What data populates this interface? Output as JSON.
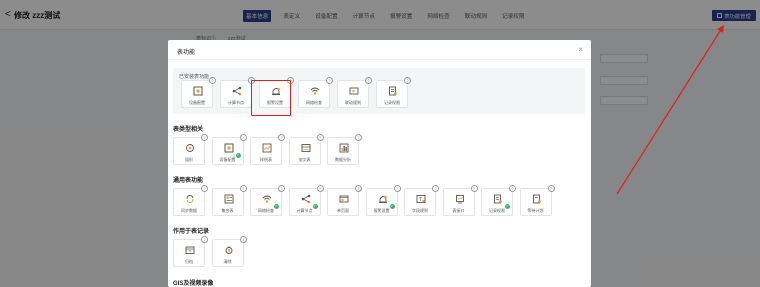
{
  "header": {
    "back_glyph": "<",
    "title": "修改 zzz测试",
    "tabs": [
      "基本信息",
      "表定义",
      "设备配置",
      "计算节点",
      "报警设置",
      "网络检查",
      "联动规则",
      "记录权限"
    ],
    "active_tab_index": 0,
    "manage_button": "表功能管理"
  },
  "background": {
    "label_1": "表标识①",
    "value_1": "zzz测试"
  },
  "modal": {
    "title": "表功能",
    "close_glyph": "×",
    "installed": {
      "label": "已安装表功能",
      "items": [
        {
          "label": "设备配置",
          "icon": "device-config-icon"
        },
        {
          "label": "计算节点",
          "icon": "compute-node-icon"
        },
        {
          "label": "报警设置",
          "icon": "alarm-icon",
          "selected": true
        },
        {
          "label": "网络检查",
          "icon": "wifi-icon"
        },
        {
          "label": "联动规则",
          "icon": "linkage-icon"
        },
        {
          "label": "记录权限",
          "icon": "record-permission-icon"
        }
      ]
    },
    "sections": [
      {
        "title": "表类型相关",
        "items": [
          {
            "label": "组织",
            "icon": "org-icon",
            "installed": false
          },
          {
            "label": "设备配置",
            "icon": "device-config-icon",
            "installed": true
          },
          {
            "label": "样例表",
            "icon": "sample-table-icon",
            "installed": false
          },
          {
            "label": "加文表",
            "icon": "text-table-icon",
            "installed": false
          },
          {
            "label": "数据分析",
            "icon": "chart-icon",
            "installed": false
          }
        ]
      },
      {
        "title": "通用表功能",
        "items": [
          {
            "label": "同步数据",
            "icon": "sync-icon",
            "installed": false
          },
          {
            "label": "集合表",
            "icon": "collection-icon",
            "installed": false
          },
          {
            "label": "网络检查",
            "icon": "wifi-icon",
            "installed": true
          },
          {
            "label": "计算节点",
            "icon": "compute-node-icon",
            "installed": true
          },
          {
            "label": "单页面",
            "icon": "single-page-icon",
            "installed": false
          },
          {
            "label": "报警设置",
            "icon": "alarm-icon",
            "installed": true
          },
          {
            "label": "字段规则",
            "icon": "field-rule-icon",
            "installed": false
          },
          {
            "label": "表接口",
            "icon": "api-icon",
            "installed": false
          },
          {
            "label": "记录权限",
            "icon": "record-permission-icon",
            "installed": true
          },
          {
            "label": "等待计划",
            "icon": "plan-icon",
            "installed": false
          }
        ]
      },
      {
        "title": "作用于表记录",
        "items": [
          {
            "label": "归档",
            "icon": "archive-icon",
            "installed": false
          },
          {
            "label": "清除",
            "icon": "clean-icon",
            "installed": false
          }
        ]
      },
      {
        "title": "GIS及视频录像",
        "items": []
      }
    ],
    "help_glyph": "?",
    "installed_badge_glyph": "✓"
  },
  "colors": {
    "primary": "#2f3f8f",
    "accent_icon": "#f0a020",
    "installed_badge": "#3db36b",
    "highlight": "#e0201b"
  }
}
